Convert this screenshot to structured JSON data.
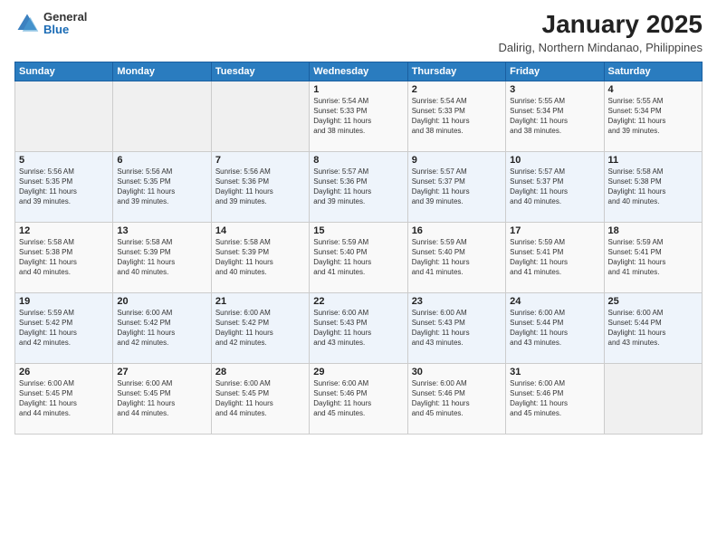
{
  "header": {
    "logo_general": "General",
    "logo_blue": "Blue",
    "title": "January 2025",
    "subtitle": "Dalirig, Northern Mindanao, Philippines"
  },
  "weekdays": [
    "Sunday",
    "Monday",
    "Tuesday",
    "Wednesday",
    "Thursday",
    "Friday",
    "Saturday"
  ],
  "weeks": [
    [
      {
        "day": "",
        "info": ""
      },
      {
        "day": "",
        "info": ""
      },
      {
        "day": "",
        "info": ""
      },
      {
        "day": "1",
        "info": "Sunrise: 5:54 AM\nSunset: 5:33 PM\nDaylight: 11 hours\nand 38 minutes."
      },
      {
        "day": "2",
        "info": "Sunrise: 5:54 AM\nSunset: 5:33 PM\nDaylight: 11 hours\nand 38 minutes."
      },
      {
        "day": "3",
        "info": "Sunrise: 5:55 AM\nSunset: 5:34 PM\nDaylight: 11 hours\nand 38 minutes."
      },
      {
        "day": "4",
        "info": "Sunrise: 5:55 AM\nSunset: 5:34 PM\nDaylight: 11 hours\nand 39 minutes."
      }
    ],
    [
      {
        "day": "5",
        "info": "Sunrise: 5:56 AM\nSunset: 5:35 PM\nDaylight: 11 hours\nand 39 minutes."
      },
      {
        "day": "6",
        "info": "Sunrise: 5:56 AM\nSunset: 5:35 PM\nDaylight: 11 hours\nand 39 minutes."
      },
      {
        "day": "7",
        "info": "Sunrise: 5:56 AM\nSunset: 5:36 PM\nDaylight: 11 hours\nand 39 minutes."
      },
      {
        "day": "8",
        "info": "Sunrise: 5:57 AM\nSunset: 5:36 PM\nDaylight: 11 hours\nand 39 minutes."
      },
      {
        "day": "9",
        "info": "Sunrise: 5:57 AM\nSunset: 5:37 PM\nDaylight: 11 hours\nand 39 minutes."
      },
      {
        "day": "10",
        "info": "Sunrise: 5:57 AM\nSunset: 5:37 PM\nDaylight: 11 hours\nand 40 minutes."
      },
      {
        "day": "11",
        "info": "Sunrise: 5:58 AM\nSunset: 5:38 PM\nDaylight: 11 hours\nand 40 minutes."
      }
    ],
    [
      {
        "day": "12",
        "info": "Sunrise: 5:58 AM\nSunset: 5:38 PM\nDaylight: 11 hours\nand 40 minutes."
      },
      {
        "day": "13",
        "info": "Sunrise: 5:58 AM\nSunset: 5:39 PM\nDaylight: 11 hours\nand 40 minutes."
      },
      {
        "day": "14",
        "info": "Sunrise: 5:58 AM\nSunset: 5:39 PM\nDaylight: 11 hours\nand 40 minutes."
      },
      {
        "day": "15",
        "info": "Sunrise: 5:59 AM\nSunset: 5:40 PM\nDaylight: 11 hours\nand 41 minutes."
      },
      {
        "day": "16",
        "info": "Sunrise: 5:59 AM\nSunset: 5:40 PM\nDaylight: 11 hours\nand 41 minutes."
      },
      {
        "day": "17",
        "info": "Sunrise: 5:59 AM\nSunset: 5:41 PM\nDaylight: 11 hours\nand 41 minutes."
      },
      {
        "day": "18",
        "info": "Sunrise: 5:59 AM\nSunset: 5:41 PM\nDaylight: 11 hours\nand 41 minutes."
      }
    ],
    [
      {
        "day": "19",
        "info": "Sunrise: 5:59 AM\nSunset: 5:42 PM\nDaylight: 11 hours\nand 42 minutes."
      },
      {
        "day": "20",
        "info": "Sunrise: 6:00 AM\nSunset: 5:42 PM\nDaylight: 11 hours\nand 42 minutes."
      },
      {
        "day": "21",
        "info": "Sunrise: 6:00 AM\nSunset: 5:42 PM\nDaylight: 11 hours\nand 42 minutes."
      },
      {
        "day": "22",
        "info": "Sunrise: 6:00 AM\nSunset: 5:43 PM\nDaylight: 11 hours\nand 43 minutes."
      },
      {
        "day": "23",
        "info": "Sunrise: 6:00 AM\nSunset: 5:43 PM\nDaylight: 11 hours\nand 43 minutes."
      },
      {
        "day": "24",
        "info": "Sunrise: 6:00 AM\nSunset: 5:44 PM\nDaylight: 11 hours\nand 43 minutes."
      },
      {
        "day": "25",
        "info": "Sunrise: 6:00 AM\nSunset: 5:44 PM\nDaylight: 11 hours\nand 43 minutes."
      }
    ],
    [
      {
        "day": "26",
        "info": "Sunrise: 6:00 AM\nSunset: 5:45 PM\nDaylight: 11 hours\nand 44 minutes."
      },
      {
        "day": "27",
        "info": "Sunrise: 6:00 AM\nSunset: 5:45 PM\nDaylight: 11 hours\nand 44 minutes."
      },
      {
        "day": "28",
        "info": "Sunrise: 6:00 AM\nSunset: 5:45 PM\nDaylight: 11 hours\nand 44 minutes."
      },
      {
        "day": "29",
        "info": "Sunrise: 6:00 AM\nSunset: 5:46 PM\nDaylight: 11 hours\nand 45 minutes."
      },
      {
        "day": "30",
        "info": "Sunrise: 6:00 AM\nSunset: 5:46 PM\nDaylight: 11 hours\nand 45 minutes."
      },
      {
        "day": "31",
        "info": "Sunrise: 6:00 AM\nSunset: 5:46 PM\nDaylight: 11 hours\nand 45 minutes."
      },
      {
        "day": "",
        "info": ""
      }
    ]
  ]
}
